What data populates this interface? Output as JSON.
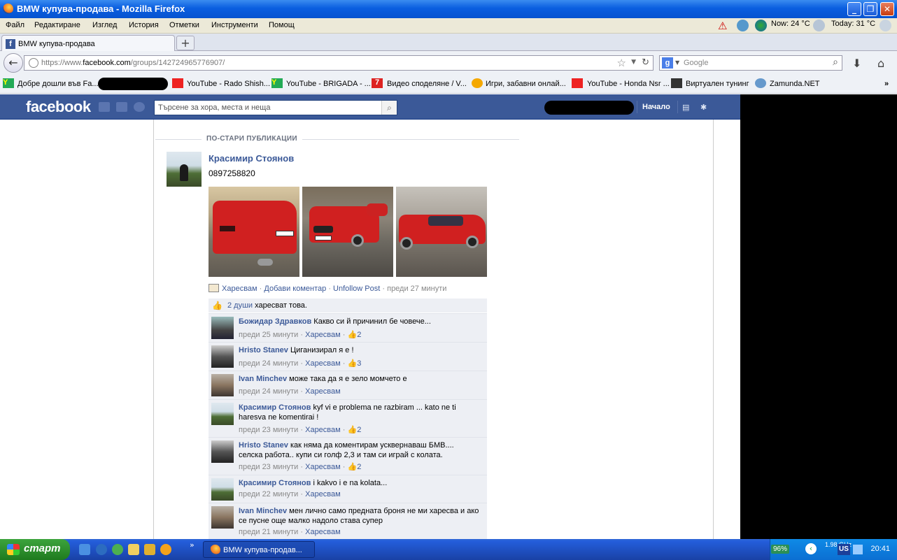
{
  "window": {
    "title": "BMW купува-продава - Mozilla Firefox",
    "minimize": "_",
    "maximize": "❐",
    "close": "✕"
  },
  "menu": [
    "Файл",
    "Редактиране",
    "Изглед",
    "История",
    "Отметки",
    "Инструменти",
    "Помощ"
  ],
  "weather": {
    "now": "Now: 24 °C",
    "today": "Today: 31 °C"
  },
  "tabs": [
    {
      "label": "BMW купува-продава"
    }
  ],
  "newtab": "+",
  "navbar": {
    "url_prefix": "https://www.",
    "url_domain": "facebook.com",
    "url_path": "/groups/142724965776907/",
    "search_placeholder": "Google",
    "search_engine": "g"
  },
  "bookmarks": [
    "Добре дошли във Fa...",
    "YouTube - Rado Shish...",
    "YouTube - BRIGADA - ...",
    "Видео споделяне / V...",
    "Игри, забавни онлай...",
    "YouTube - Honda Nsr ...",
    "Виртуален тунинг",
    "Zamunda.NET"
  ],
  "bookmarks_more": "»",
  "facebook": {
    "logo": "facebook",
    "search_placeholder": "Търсене за хора, места и неща",
    "home": "Начало",
    "brand_color": "#3b5998"
  },
  "feed": {
    "section_header": "ПО-СТАРИ ПУБЛИКАЦИИ",
    "post": {
      "author": "Красимир Стоянов",
      "message": "0897258820",
      "action_like": "Харесвам",
      "action_comment": "Добави коментар",
      "action_unfollow": "Unfollow Post",
      "time": "преди 27 минути",
      "sep": "·",
      "likes_count": "2 души",
      "likes_text": "харесват това."
    },
    "comments": [
      {
        "name": "Божидар Здравков",
        "text": "Какво си й причинил бе човече...",
        "time": "преди 25 минути",
        "like": "Харесвам",
        "likes": "2"
      },
      {
        "name": "Hristo Stanev",
        "text": "Циганизирал я е !",
        "time": "преди 24 минути",
        "like": "Харесвам",
        "likes": "3"
      },
      {
        "name": "Ivan Minchev",
        "text": "може така да я е зело момчето е",
        "time": "преди 24 минути",
        "like": "Харесвам",
        "likes": ""
      },
      {
        "name": "Красимир Стоянов",
        "text": "kyf vi e problema ne razbiram ... kato ne ti haresva ne komentirai !",
        "time": "преди 23 минути",
        "like": "Харесвам",
        "likes": "2"
      },
      {
        "name": "Hristo Stanev",
        "text": "как няма да коментирам усквернаваш БМВ.... селска работа.. купи си голф 2,3 и там си играй с колата.",
        "time": "преди 23 минути",
        "like": "Харесвам",
        "likes": "2"
      },
      {
        "name": "Красимир Стоянов",
        "text": "i kakvo i e na kolata...",
        "time": "преди 22 минути",
        "like": "Харесвам",
        "likes": ""
      },
      {
        "name": "Ivan Minchev",
        "text": "мен лично само предната броня не ми харесва и ако се пусне още малко надоло става супер",
        "time": "преди 21 минути",
        "like": "Харесвам",
        "likes": ""
      }
    ]
  },
  "taskbar": {
    "start": "старт",
    "task": "BMW купува-продав...",
    "clock": "20:41",
    "lang": "US",
    "cpu": "1.98 GHz",
    "battery": "96%",
    "overflow": "»"
  }
}
